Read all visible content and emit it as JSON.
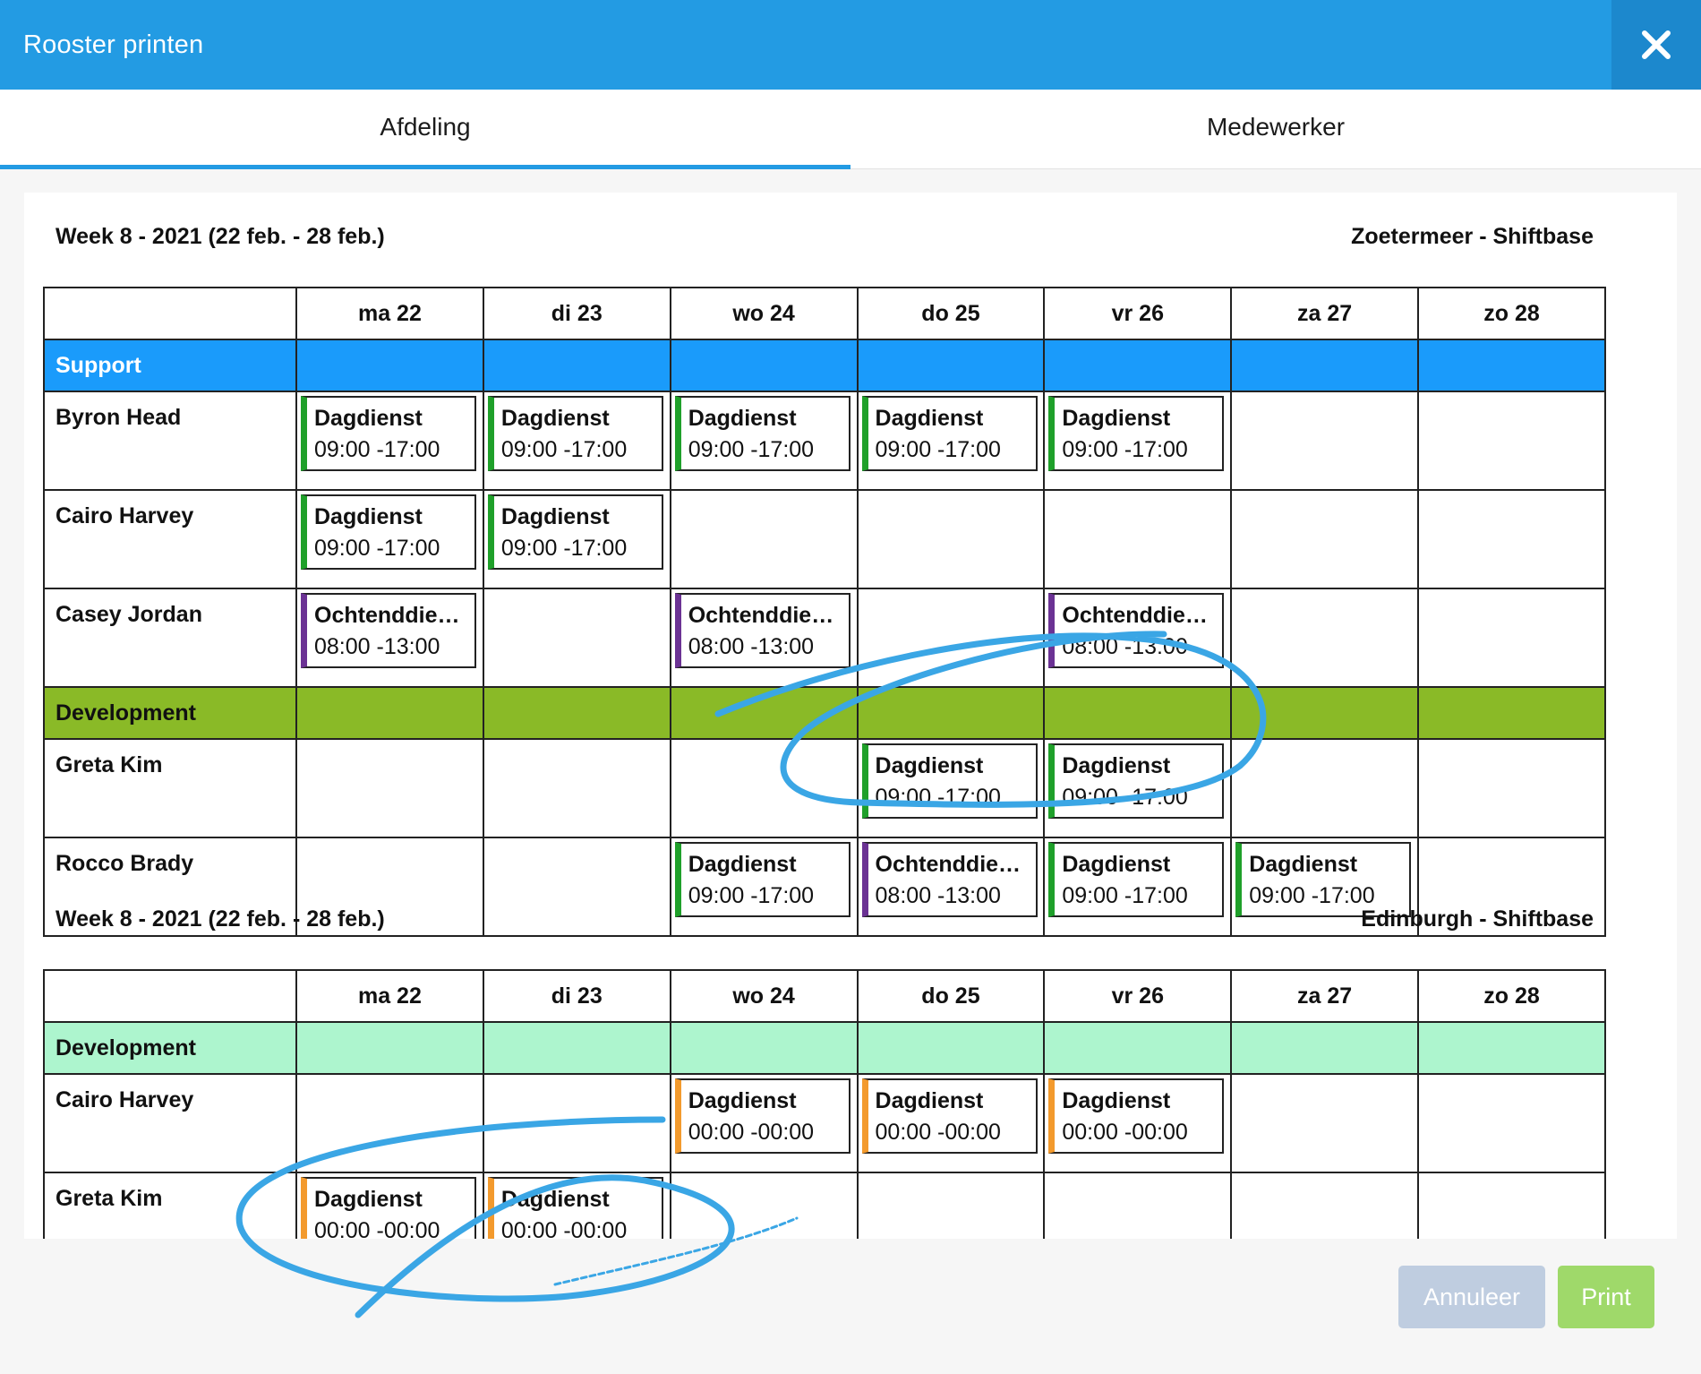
{
  "window": {
    "title": "Rooster printen",
    "close_icon": "close-icon"
  },
  "tabs": [
    {
      "label": "Afdeling",
      "active": true
    },
    {
      "label": "Medewerker",
      "active": false
    }
  ],
  "colors": {
    "header": "#239be3",
    "support": "#1a9bfb",
    "development_1": "#8aba27",
    "development_2": "#adf5ce",
    "shift_green": "#1fa02a",
    "shift_purple": "#6b3294",
    "shift_orange": "#f39a2d",
    "annotation": "#3aa6e5"
  },
  "days": [
    "ma 22",
    "di 23",
    "wo 24",
    "do 25",
    "vr 26",
    "za 27",
    "zo 28"
  ],
  "weeks": [
    {
      "week_label": "Week 8 - 2021 (22 feb. - 28 feb.)",
      "location": "Zoetermeer - Shiftbase",
      "groups": [
        {
          "name": "Support",
          "color": "#1a9bfb",
          "text_color": "#ffffff",
          "employees": [
            {
              "name": "Byron Head",
              "shifts": [
                {
                  "day": 0,
                  "name": "Dagdienst",
                  "time": "09:00 -17:00",
                  "color": "#1fa02a"
                },
                {
                  "day": 1,
                  "name": "Dagdienst",
                  "time": "09:00 -17:00",
                  "color": "#1fa02a"
                },
                {
                  "day": 2,
                  "name": "Dagdienst",
                  "time": "09:00 -17:00",
                  "color": "#1fa02a"
                },
                {
                  "day": 3,
                  "name": "Dagdienst",
                  "time": "09:00 -17:00",
                  "color": "#1fa02a"
                },
                {
                  "day": 4,
                  "name": "Dagdienst",
                  "time": "09:00 -17:00",
                  "color": "#1fa02a"
                }
              ]
            },
            {
              "name": "Cairo Harvey",
              "shifts": [
                {
                  "day": 0,
                  "name": "Dagdienst",
                  "time": "09:00 -17:00",
                  "color": "#1fa02a"
                },
                {
                  "day": 1,
                  "name": "Dagdienst",
                  "time": "09:00 -17:00",
                  "color": "#1fa02a"
                }
              ]
            },
            {
              "name": "Casey Jordan",
              "shifts": [
                {
                  "day": 0,
                  "name": "Ochtenddienst",
                  "time": "08:00 -13:00",
                  "color": "#6b3294"
                },
                {
                  "day": 2,
                  "name": "Ochtenddienst",
                  "time": "08:00 -13:00",
                  "color": "#6b3294"
                },
                {
                  "day": 4,
                  "name": "Ochtenddienst",
                  "time": "08:00 -13:00",
                  "color": "#6b3294"
                }
              ]
            }
          ]
        },
        {
          "name": "Development",
          "color": "#8aba27",
          "text_color": "#111111",
          "employees": [
            {
              "name": "Greta Kim",
              "shifts": [
                {
                  "day": 3,
                  "name": "Dagdienst",
                  "time": "09:00 -17:00",
                  "color": "#1fa02a"
                },
                {
                  "day": 4,
                  "name": "Dagdienst",
                  "time": "09:00 -17:00",
                  "color": "#1fa02a"
                }
              ]
            },
            {
              "name": "Rocco Brady",
              "shifts": [
                {
                  "day": 2,
                  "name": "Dagdienst",
                  "time": "09:00 -17:00",
                  "color": "#1fa02a"
                },
                {
                  "day": 3,
                  "name": "Ochtenddienst",
                  "time": "08:00 -13:00",
                  "color": "#6b3294"
                },
                {
                  "day": 4,
                  "name": "Dagdienst",
                  "time": "09:00 -17:00",
                  "color": "#1fa02a"
                },
                {
                  "day": 5,
                  "name": "Dagdienst",
                  "time": "09:00 -17:00",
                  "color": "#1fa02a"
                }
              ]
            }
          ]
        }
      ]
    },
    {
      "week_label": "Week 8 - 2021 (22 feb. - 28 feb.)",
      "location": "Edinburgh - Shiftbase",
      "groups": [
        {
          "name": "Development",
          "color": "#adf5ce",
          "text_color": "#111111",
          "employees": [
            {
              "name": "Cairo Harvey",
              "shifts": [
                {
                  "day": 2,
                  "name": "Dagdienst",
                  "time": "00:00 -00:00",
                  "color": "#f39a2d"
                },
                {
                  "day": 3,
                  "name": "Dagdienst",
                  "time": "00:00 -00:00",
                  "color": "#f39a2d"
                },
                {
                  "day": 4,
                  "name": "Dagdienst",
                  "time": "00:00 -00:00",
                  "color": "#f39a2d"
                }
              ]
            },
            {
              "name": "Greta Kim",
              "shifts": [
                {
                  "day": 0,
                  "name": "Dagdienst",
                  "time": "00:00 -00:00",
                  "color": "#f39a2d"
                },
                {
                  "day": 1,
                  "name": "Dagdienst",
                  "time": "00:00 -00:00",
                  "color": "#f39a2d"
                }
              ]
            }
          ]
        }
      ]
    }
  ],
  "footer": {
    "cancel_label": "Annuleer",
    "print_label": "Print"
  }
}
